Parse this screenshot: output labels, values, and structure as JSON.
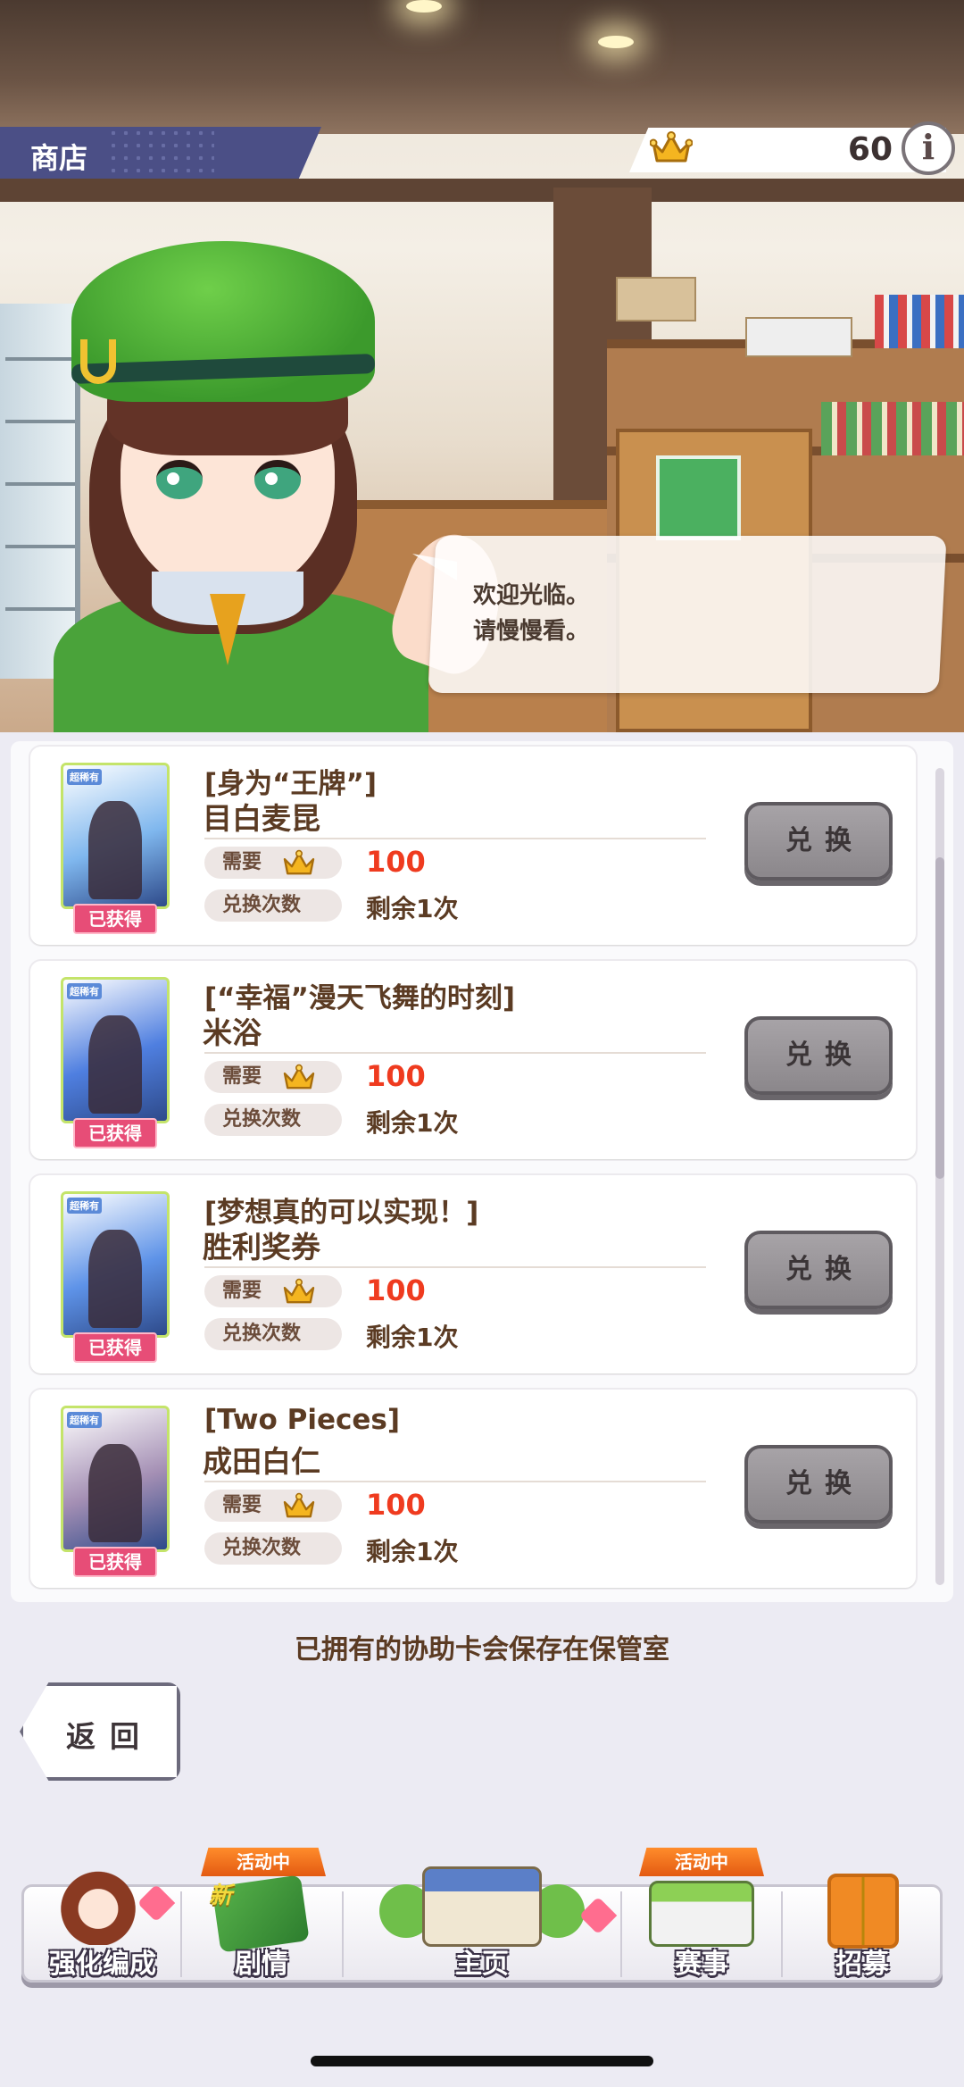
{
  "header": {
    "title": "商店",
    "currency_value": "60",
    "info_label": "i"
  },
  "dialogue": {
    "line1": "欢迎光临。",
    "line2": "请慢慢看。"
  },
  "items": [
    {
      "title": "[身为“王牌”]",
      "name": "目白麦昆",
      "need_label": "需要",
      "cost": "100",
      "count_label": "兑换次数",
      "remaining": "剩余1次",
      "owned_badge": "已获得",
      "rarity": "超稀有",
      "button": "兑换",
      "thumb_color": "#7fb7ee"
    },
    {
      "title": "[“幸福”漫天飞舞的时刻]",
      "name": "米浴",
      "need_label": "需要",
      "cost": "100",
      "count_label": "兑换次数",
      "remaining": "剩余1次",
      "owned_badge": "已获得",
      "rarity": "超稀有",
      "button": "兑换",
      "thumb_color": "#4f7fe0"
    },
    {
      "title": "[梦想真的可以实现！]",
      "name": "胜利奖券",
      "need_label": "需要",
      "cost": "100",
      "count_label": "兑换次数",
      "remaining": "剩余1次",
      "owned_badge": "已获得",
      "rarity": "超稀有",
      "button": "兑换",
      "thumb_color": "#5e93e8"
    },
    {
      "title": "[Two Pieces]",
      "name": "成田白仁",
      "need_label": "需要",
      "cost": "100",
      "count_label": "兑换次数",
      "remaining": "剩余1次",
      "owned_badge": "已获得",
      "rarity": "超稀有",
      "button": "兑换",
      "thumb_color": "#a48fb4"
    }
  ],
  "footer_note": "已拥有的协助卡会保存在保管室",
  "back_button": "返回",
  "nav": {
    "items": [
      {
        "label": "强化编成",
        "icon": "character-icon"
      },
      {
        "label": "剧情",
        "icon": "story-book-icon",
        "event_tag": "活动中",
        "new_tag": "新"
      },
      {
        "label": "主页",
        "icon": "school-building-icon"
      },
      {
        "label": "赛事",
        "icon": "race-gate-icon",
        "event_tag": "活动中"
      },
      {
        "label": "招募",
        "icon": "gacha-door-icon"
      }
    ]
  },
  "colors": {
    "accent_button": "#8b878b",
    "cost_red": "#ef3b1f",
    "badge_pink": "#e74d77",
    "title_tag": "#4b4f86"
  }
}
